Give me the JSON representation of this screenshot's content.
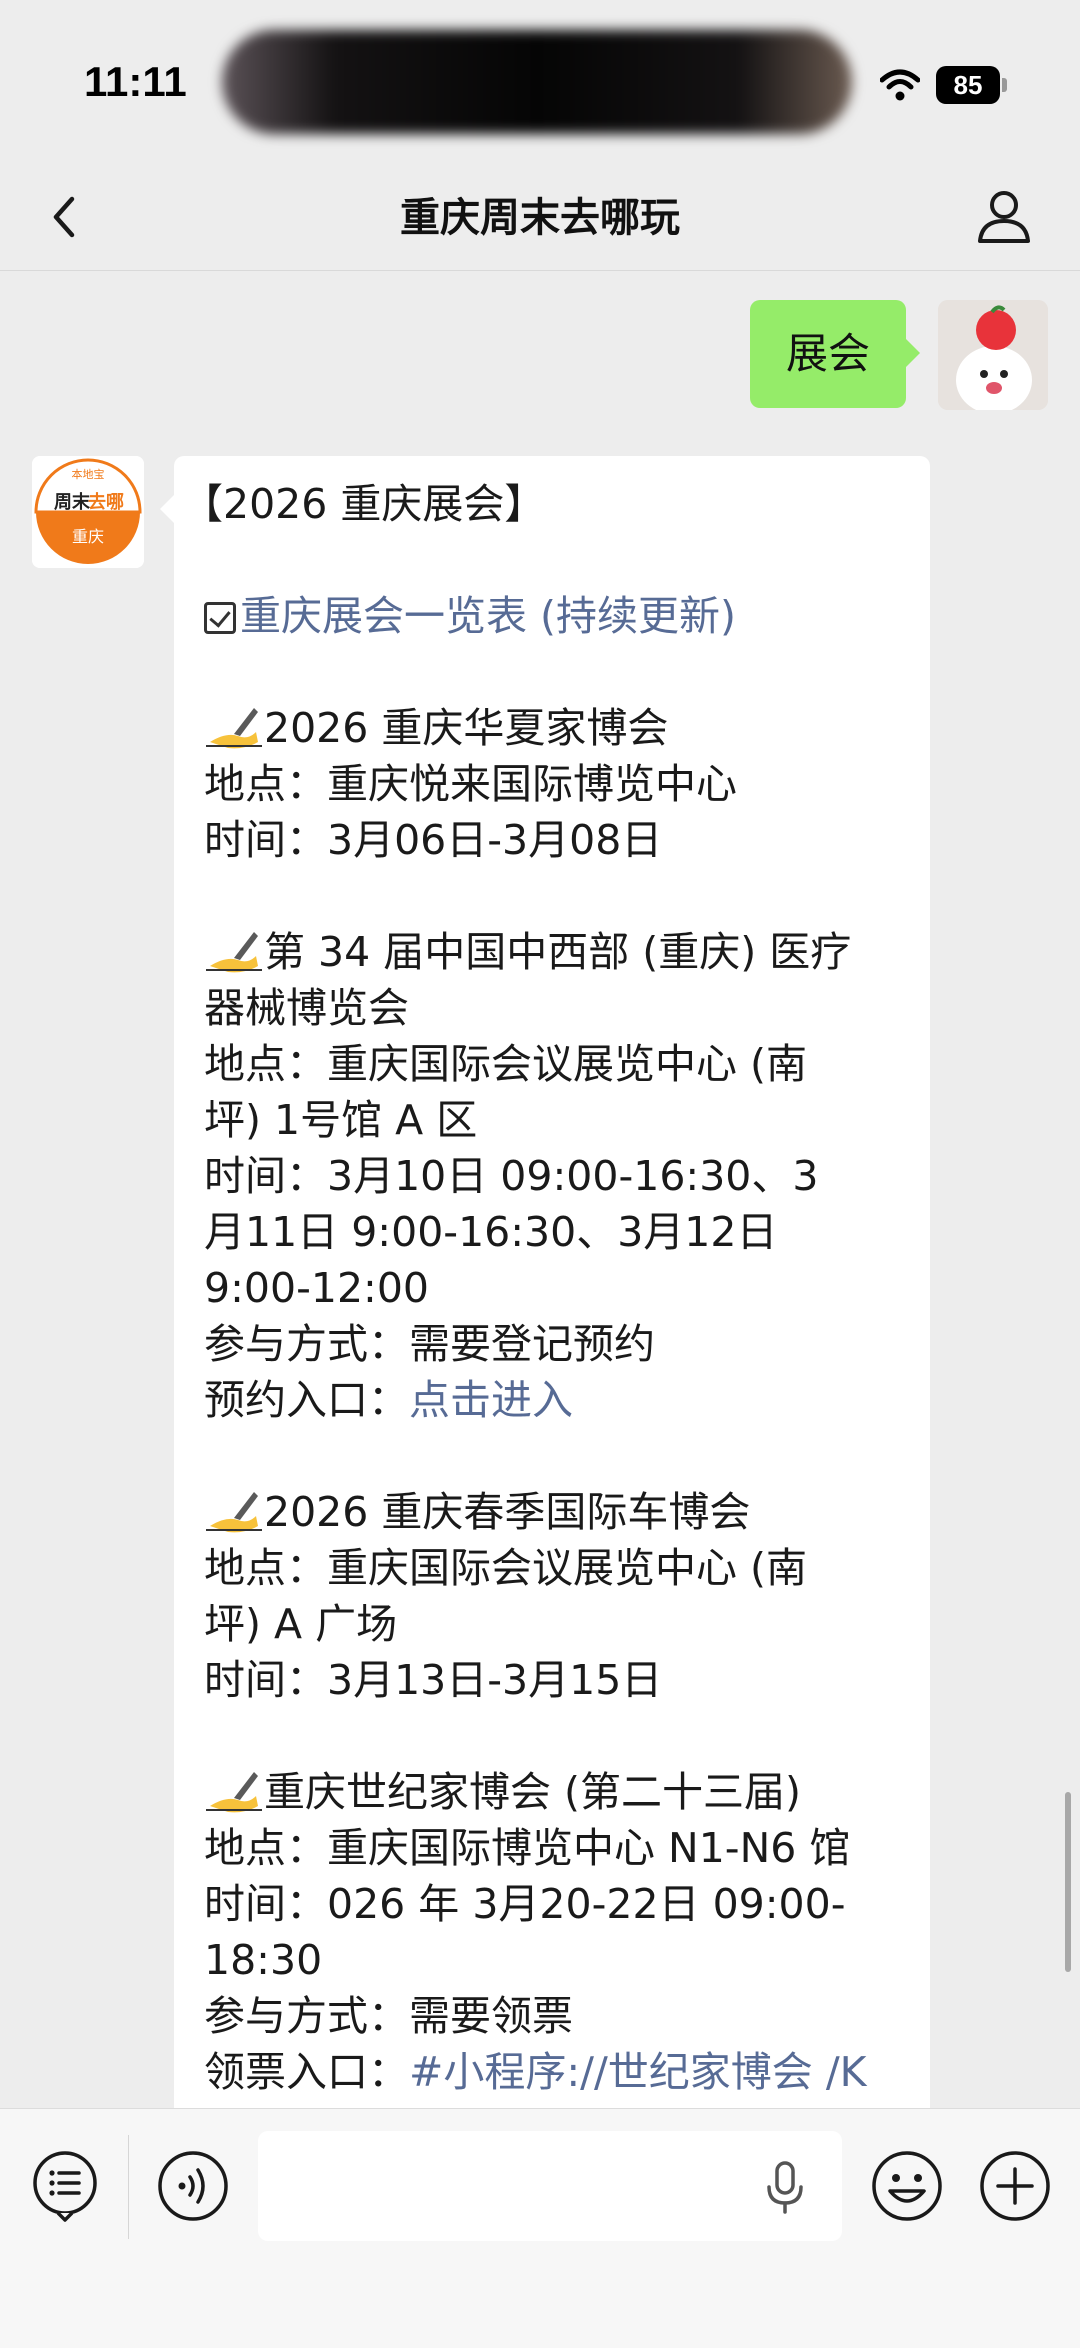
{
  "status_bar": {
    "time": "11:11",
    "battery": "85"
  },
  "nav": {
    "title": "重庆周末去哪玩"
  },
  "messages": {
    "user_text": "展会",
    "bot_avatar": {
      "top": "本地宝",
      "middle_a": "周末",
      "middle_b": "去哪",
      "bottom": "重庆"
    },
    "bot_title": "【2026 重庆展会】",
    "bot_list_link": "重庆展会一览表 (持续更新)",
    "event1": {
      "name": "2026 重庆华夏家博会",
      "place": "地点：重庆悦来国际博览中心",
      "time": "时间：3月06日-3月08日"
    },
    "event2": {
      "name_1": "第 34 届中国中西部 (重庆) 医疗",
      "name_2": "器械博览会",
      "place_1": "地点：重庆国际会议展览中心 (南",
      "place_2": "坪) 1号馆 A 区",
      "time_1": "时间：3月10日 09:00-16:30、3",
      "time_2": "月11日 9:00-16:30、3月12日",
      "time_3": "9:00-12:00",
      "method": "参与方式：需要登记预约",
      "entry_label": "预约入口：",
      "entry_link": "点击进入"
    },
    "event3": {
      "name": "2026 重庆春季国际车博会",
      "place_1": "地点：重庆国际会议展览中心 (南",
      "place_2": "坪) A 广场",
      "time": "时间：3月13日-3月15日"
    },
    "event4": {
      "name": "重庆世纪家博会 (第二十三届)",
      "place": "地点：重庆国际博览中心 N1-N6 馆",
      "time_1": "时间：026 年 3月20-22日 09:00-",
      "time_2": "18:30",
      "method": "参与方式：需要领票",
      "entry_label": "领票入口：",
      "entry_link": "#小程序://世纪家博会 /K"
    }
  },
  "icons": {
    "back": "chevron-left-icon",
    "profile": "person-icon",
    "menu": "list-menu-icon",
    "voice": "voice-icon",
    "mic": "microphone-icon",
    "emoji": "smiley-icon",
    "add": "plus-icon",
    "write": "writing-hand-icon",
    "check": "checkbox-icon"
  },
  "colors": {
    "background": "#ededed",
    "user_bubble": "#95ec69",
    "link": "#576b95",
    "brand_orange": "#f07a1a"
  }
}
